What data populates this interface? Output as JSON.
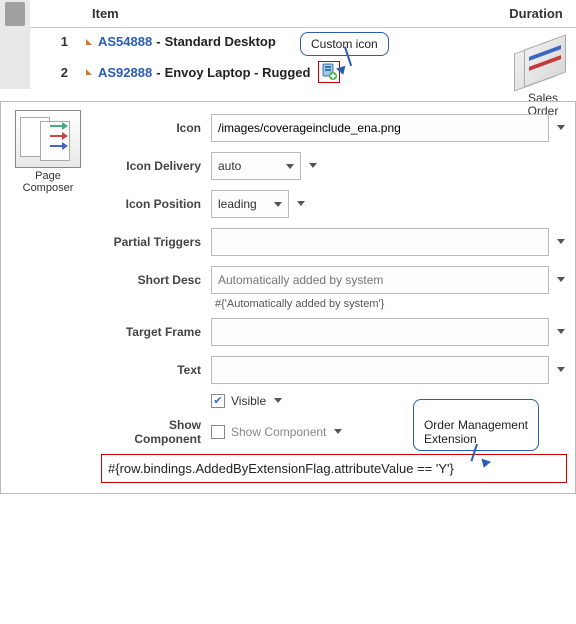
{
  "table": {
    "headers": {
      "item": "Item",
      "duration": "Duration"
    },
    "rows": [
      {
        "num": "1",
        "code": "AS54888",
        "sep": "-",
        "name": "Standard Desktop"
      },
      {
        "num": "2",
        "code": "AS92888",
        "sep": "-",
        "name": "Envoy Laptop - Rugged"
      }
    ]
  },
  "callouts": {
    "customIcon": "Custom icon",
    "orderMgmt": "Order Management\nExtension"
  },
  "salesOrder": {
    "label": "Sales\nOrder"
  },
  "pageComposer": {
    "label": "Page\nComposer"
  },
  "form": {
    "icon": {
      "label": "Icon",
      "value": "/images/coverageinclude_ena.png"
    },
    "iconDelivery": {
      "label": "Icon Delivery",
      "value": "auto"
    },
    "iconPosition": {
      "label": "Icon Position",
      "value": "leading"
    },
    "partialTriggers": {
      "label": "Partial Triggers",
      "value": ""
    },
    "shortDesc": {
      "label": "Short Desc",
      "placeholder": "Automatically added by system",
      "hint": "#{'Automatically added by system'}"
    },
    "targetFrame": {
      "label": "Target Frame",
      "value": ""
    },
    "text": {
      "label": "Text",
      "value": ""
    },
    "visible": {
      "label": "Visible"
    },
    "showComponent": {
      "label": "Show Component",
      "text": "Show Component"
    }
  },
  "expression": "#{row.bindings.AddedByExtensionFlag.attributeValue == 'Y'}"
}
